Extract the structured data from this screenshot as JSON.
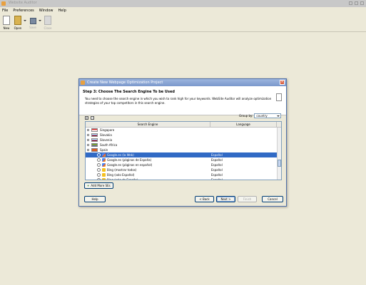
{
  "app": {
    "title": "Website Auditor"
  },
  "menu": [
    "File",
    "Preferences",
    "Window",
    "Help"
  ],
  "toolbar": {
    "new_label": "New",
    "open_label": "Open",
    "save_label": "Save",
    "close_label": "Close"
  },
  "dialog": {
    "title": "Create New Webpage Optimization Project",
    "step_title": "Step 3: Choose The Search Engine To be Used",
    "description": "You need to choose the search engine in which you wish to rank high for your keywords. WebSite Auditor will analyze optimization strategies of your top competitors in this search engine.",
    "group_by_label": "Group by:",
    "group_by_value": "country",
    "columns": [
      "Search Engine",
      "Language"
    ],
    "countries": [
      {
        "name": "Singapore",
        "flag_colors": [
          "#e03030",
          "#ffffff"
        ]
      },
      {
        "name": "Slovakia",
        "flag_colors": [
          "#ffffff",
          "#1f4fa8",
          "#e03030"
        ]
      },
      {
        "name": "Slovenia",
        "flag_colors": [
          "#ffffff",
          "#1f4fa8",
          "#e03030"
        ]
      },
      {
        "name": "South Africa",
        "flag_colors": [
          "#2a8a3a",
          "#f4c020",
          "#1f4fa8"
        ]
      },
      {
        "name": "Spain",
        "flag_colors": [
          "#c81e1e",
          "#f4c020",
          "#c81e1e"
        ]
      }
    ],
    "engines": [
      {
        "name": "Google.es (la Web)",
        "language": "Español",
        "checked": true,
        "selected": true,
        "icon": "google-icon"
      },
      {
        "name": "Google.es (páginas de España)",
        "language": "Español",
        "checked": false,
        "selected": false,
        "icon": "google-icon"
      },
      {
        "name": "Google.es (páginas en español)",
        "language": "Español",
        "checked": false,
        "selected": false,
        "icon": "google-icon"
      },
      {
        "name": "Bing (mostrar todos)",
        "language": "Español",
        "checked": false,
        "selected": false,
        "icon": "bing-icon"
      },
      {
        "name": "Bing (solo Español)",
        "language": "Español",
        "checked": false,
        "selected": false,
        "icon": "bing-icon"
      },
      {
        "name": "Bing (solo de España)",
        "language": "Español",
        "checked": false,
        "selected": false,
        "icon": "bing-icon"
      }
    ],
    "add_more_label": "Add More SEs",
    "buttons": {
      "help": "Help",
      "back": "< Back",
      "next": "Next >",
      "finish": "Finish",
      "cancel": "Cancel"
    }
  }
}
